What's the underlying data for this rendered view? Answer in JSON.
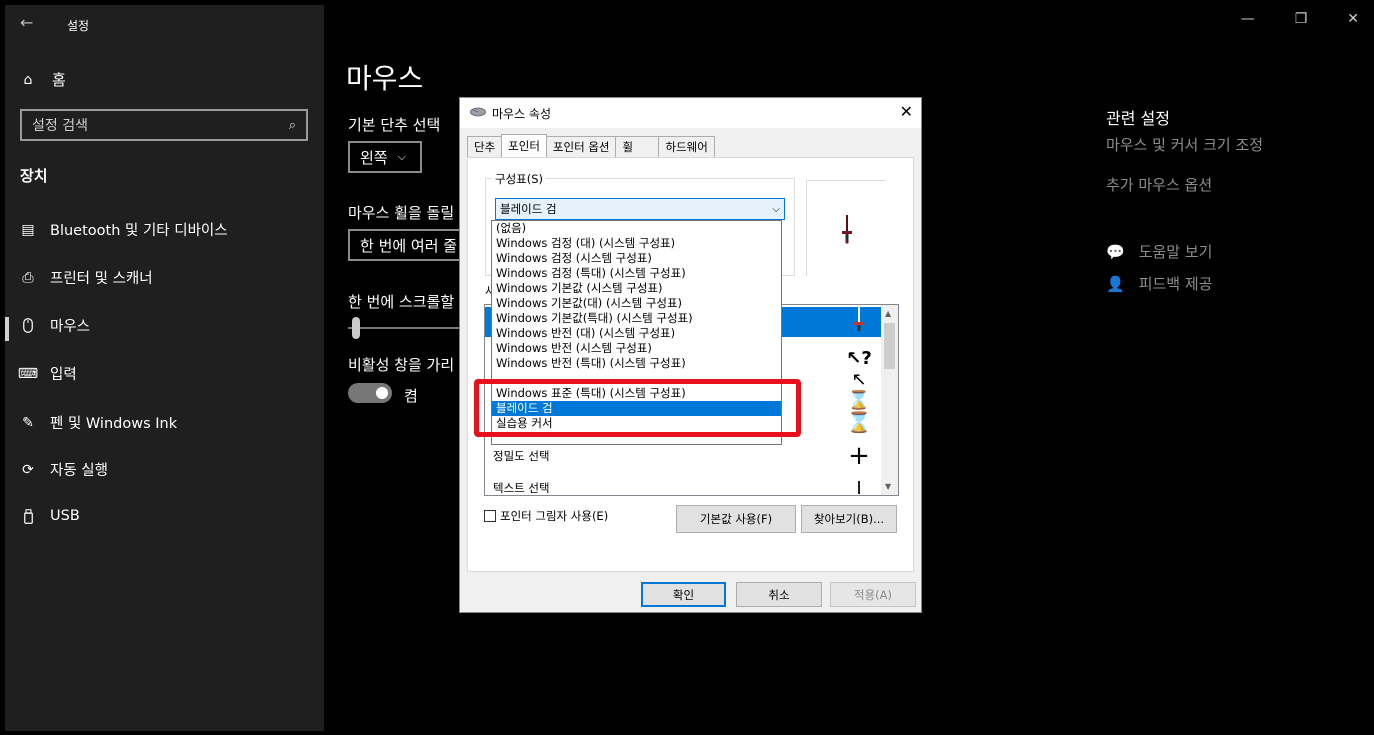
{
  "settings": {
    "app_title": "설정",
    "home_label": "홈",
    "search_placeholder": "설정 검색",
    "section_heading": "장치",
    "nav_items": [
      {
        "label": "Bluetooth 및 기타 디바이스",
        "icon": "keyboard-device-icon"
      },
      {
        "label": "프린터 및 스캐너",
        "icon": "printer-icon"
      },
      {
        "label": "마우스",
        "icon": "mouse-icon"
      },
      {
        "label": "입력",
        "icon": "keyboard-icon"
      },
      {
        "label": "펜 및 Windows Ink",
        "icon": "pen-icon"
      },
      {
        "label": "자동 실행",
        "icon": "autoplay-icon"
      },
      {
        "label": "USB",
        "icon": "usb-icon"
      }
    ],
    "active_nav": "마우스"
  },
  "main": {
    "title": "마우스",
    "primary_button_label": "기본 단추 선택",
    "primary_button_value": "왼쪽",
    "wheel_label": "마우스 휠을 돌릴",
    "wheel_value": "한 번에 여러 줄",
    "scroll_lines_label": "한 번에 스크롤할",
    "inactive_scroll_label": "비활성 창을 가리",
    "inactive_scroll_state": "켬",
    "related_title": "관련 설정",
    "related_links": [
      "마우스 및 커서 크기 조정",
      "추가 마우스 옵션"
    ],
    "help_links": [
      {
        "label": "도움말 보기",
        "icon": "help-chat-icon"
      },
      {
        "label": "피드백 제공",
        "icon": "feedback-icon"
      }
    ]
  },
  "dialog": {
    "title": "마우스 속성",
    "tabs": [
      "단추",
      "포인터",
      "포인터 옵션",
      "휠",
      "하드웨어"
    ],
    "active_tab": "포인터",
    "scheme_group_label": "구성표(S)",
    "scheme_selected": "블레이드 검",
    "custom_label": "사",
    "cursor_rows": [
      {
        "label": "",
        "glyph": "🗡",
        "selected": true
      },
      {
        "label": "",
        "glyph": "⇱?",
        "selected": false
      },
      {
        "label": "",
        "glyph": "⇱⌛",
        "selected": false
      },
      {
        "label": "",
        "glyph": "⌛",
        "selected": false
      },
      {
        "label": "정밀도 선택",
        "glyph": "+",
        "selected": false
      },
      {
        "label": "텍스트 선택",
        "glyph": "I",
        "selected": false
      }
    ],
    "shadow_checkbox_label": "포인터 그림자 사용(E)",
    "default_button": "기본값 사용(F)",
    "browse_button": "찾아보기(B)...",
    "ok_button": "확인",
    "cancel_button": "취소",
    "apply_button": "적용(A)",
    "dropdown_options": [
      "(없음)",
      "Windows 검정 (대) (시스템 구성표)",
      "Windows 검정 (시스템 구성표)",
      "Windows 검정 (특대) (시스템 구성표)",
      "Windows 기본값 (시스템 구성표)",
      "Windows 기본값(대) (시스템 구성표)",
      "Windows 기본값(특대) (시스템 구성표)",
      "Windows 반전 (대) (시스템 구성표)",
      "Windows 반전 (시스템 구성표)",
      "Windows 반전 (특대) (시스템 구성표)",
      "Windows 표준 (특대) (시스템 구성표)",
      "블레이드 검",
      "실습용 커서"
    ],
    "dropdown_selected": "블레이드 검"
  },
  "colors": {
    "sidebar_bg": "#1f1f1f",
    "accent": "#0078d7",
    "highlight_annotation": "#e8101a"
  }
}
